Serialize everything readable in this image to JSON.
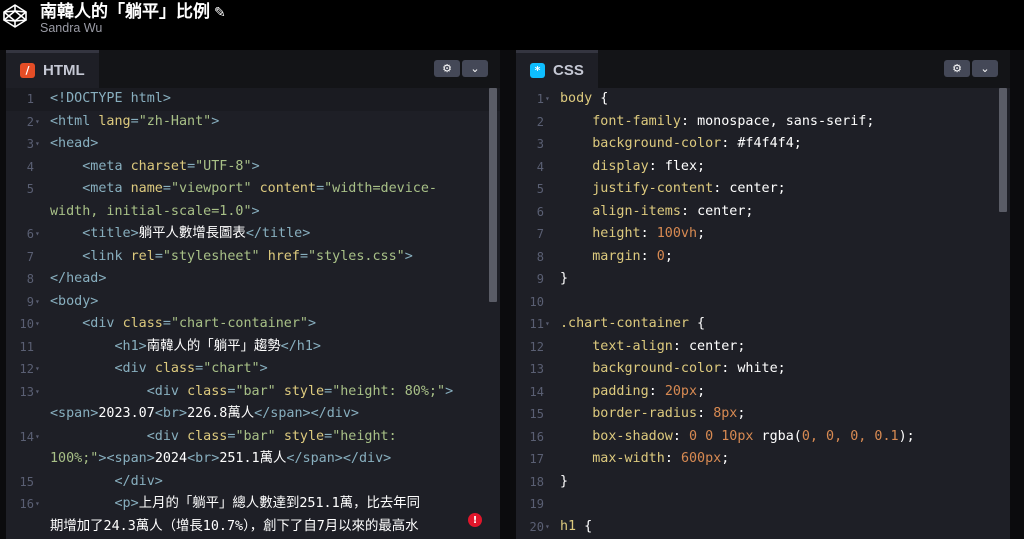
{
  "header": {
    "title": "南韓人的「躺平」比例",
    "author": "Sandra Wu"
  },
  "html_panel": {
    "tab_label": "HTML",
    "badge": "/",
    "lines": [
      {
        "n": "1",
        "fold": false,
        "highlight": true,
        "segs": [
          [
            "tag",
            "<!DOCTYPE html>"
          ]
        ]
      },
      {
        "n": "2",
        "fold": true,
        "segs": [
          [
            "tag",
            "<html "
          ],
          [
            "attr",
            "lang"
          ],
          [
            "tag",
            "="
          ],
          [
            "val",
            "\"zh-Hant\""
          ],
          [
            "tag",
            ">"
          ]
        ]
      },
      {
        "n": "3",
        "fold": true,
        "segs": [
          [
            "tag",
            "<head>"
          ]
        ]
      },
      {
        "n": "4",
        "fold": false,
        "segs": [
          [
            "tag",
            "    <meta "
          ],
          [
            "attr",
            "charset"
          ],
          [
            "tag",
            "="
          ],
          [
            "val",
            "\"UTF-8\""
          ],
          [
            "tag",
            ">"
          ]
        ]
      },
      {
        "n": "5",
        "fold": false,
        "segs": [
          [
            "tag",
            "    <meta "
          ],
          [
            "attr",
            "name"
          ],
          [
            "tag",
            "="
          ],
          [
            "val",
            "\"viewport\""
          ],
          [
            "tag",
            " "
          ],
          [
            "attr",
            "content"
          ],
          [
            "tag",
            "="
          ],
          [
            "val",
            "\"width=device-"
          ]
        ]
      },
      {
        "n": "",
        "fold": false,
        "segs": [
          [
            "val",
            "width, initial-scale=1.0\""
          ],
          [
            "tag",
            ">"
          ]
        ]
      },
      {
        "n": "6",
        "fold": true,
        "segs": [
          [
            "tag",
            "    <title>"
          ],
          [
            "white",
            "躺平人數增長圖表"
          ],
          [
            "tag",
            "</title>"
          ]
        ]
      },
      {
        "n": "7",
        "fold": false,
        "segs": [
          [
            "tag",
            "    <link "
          ],
          [
            "attr",
            "rel"
          ],
          [
            "tag",
            "="
          ],
          [
            "val",
            "\"stylesheet\""
          ],
          [
            "tag",
            " "
          ],
          [
            "attr",
            "href"
          ],
          [
            "tag",
            "="
          ],
          [
            "val",
            "\"styles.css\""
          ],
          [
            "tag",
            ">"
          ]
        ]
      },
      {
        "n": "8",
        "fold": false,
        "segs": [
          [
            "tag",
            "</head>"
          ]
        ]
      },
      {
        "n": "9",
        "fold": true,
        "segs": [
          [
            "tag",
            "<body>"
          ]
        ]
      },
      {
        "n": "10",
        "fold": true,
        "segs": [
          [
            "tag",
            "    <div "
          ],
          [
            "attr",
            "class"
          ],
          [
            "tag",
            "="
          ],
          [
            "val",
            "\"chart-container\""
          ],
          [
            "tag",
            ">"
          ]
        ]
      },
      {
        "n": "11",
        "fold": false,
        "segs": [
          [
            "tag",
            "        <h1>"
          ],
          [
            "white",
            "南韓人的「躺平」趨勢"
          ],
          [
            "tag",
            "</h1>"
          ]
        ]
      },
      {
        "n": "12",
        "fold": true,
        "segs": [
          [
            "tag",
            "        <div "
          ],
          [
            "attr",
            "class"
          ],
          [
            "tag",
            "="
          ],
          [
            "val",
            "\"chart\""
          ],
          [
            "tag",
            ">"
          ]
        ]
      },
      {
        "n": "13",
        "fold": true,
        "segs": [
          [
            "tag",
            "            <div "
          ],
          [
            "attr",
            "class"
          ],
          [
            "tag",
            "="
          ],
          [
            "val",
            "\"bar\""
          ],
          [
            "tag",
            " "
          ],
          [
            "attr",
            "style"
          ],
          [
            "tag",
            "="
          ],
          [
            "val",
            "\"height: 80%;\""
          ],
          [
            "tag",
            ">"
          ]
        ]
      },
      {
        "n": "",
        "fold": false,
        "segs": [
          [
            "tag",
            "<span>"
          ],
          [
            "white",
            "2023.07"
          ],
          [
            "tag",
            "<br>"
          ],
          [
            "white",
            "226.8萬人"
          ],
          [
            "tag",
            "</span></div>"
          ]
        ]
      },
      {
        "n": "14",
        "fold": true,
        "segs": [
          [
            "tag",
            "            <div "
          ],
          [
            "attr",
            "class"
          ],
          [
            "tag",
            "="
          ],
          [
            "val",
            "\"bar\""
          ],
          [
            "tag",
            " "
          ],
          [
            "attr",
            "style"
          ],
          [
            "tag",
            "="
          ],
          [
            "val",
            "\"height:"
          ]
        ]
      },
      {
        "n": "",
        "fold": false,
        "segs": [
          [
            "val",
            "100%;\""
          ],
          [
            "tag",
            ">"
          ],
          [
            "tag",
            "<span>"
          ],
          [
            "white",
            "2024"
          ],
          [
            "tag",
            "<br>"
          ],
          [
            "white",
            "251.1萬人"
          ],
          [
            "tag",
            "</span></div>"
          ]
        ]
      },
      {
        "n": "15",
        "fold": false,
        "segs": [
          [
            "tag",
            "        </div>"
          ]
        ]
      },
      {
        "n": "16",
        "fold": true,
        "segs": [
          [
            "tag",
            "        <p>"
          ],
          [
            "white",
            "上月的「躺平」總人數達到251.1萬，比去年同"
          ]
        ]
      },
      {
        "n": "",
        "fold": false,
        "segs": [
          [
            "white",
            "期增加了24.3萬人（增長10.7%），創下了自7月以來的最高水"
          ]
        ]
      }
    ]
  },
  "css_panel": {
    "tab_label": "CSS",
    "badge": "*",
    "lines": [
      {
        "n": "1",
        "fold": true,
        "segs": [
          [
            "sel",
            "body"
          ],
          [
            "white",
            " {"
          ]
        ]
      },
      {
        "n": "2",
        "fold": false,
        "segs": [
          [
            "prop",
            "    font-family"
          ],
          [
            "white",
            ": "
          ],
          [
            "white",
            "monospace, sans-serif;"
          ]
        ]
      },
      {
        "n": "3",
        "fold": false,
        "segs": [
          [
            "prop",
            "    background-color"
          ],
          [
            "white",
            ": "
          ],
          [
            "white",
            "#f4f4f4;"
          ]
        ]
      },
      {
        "n": "4",
        "fold": false,
        "segs": [
          [
            "prop",
            "    display"
          ],
          [
            "white",
            ": "
          ],
          [
            "white",
            "flex;"
          ]
        ]
      },
      {
        "n": "5",
        "fold": false,
        "segs": [
          [
            "prop",
            "    justify-content"
          ],
          [
            "white",
            ": "
          ],
          [
            "white",
            "center;"
          ]
        ]
      },
      {
        "n": "6",
        "fold": false,
        "segs": [
          [
            "prop",
            "    align-items"
          ],
          [
            "white",
            ": "
          ],
          [
            "white",
            "center;"
          ]
        ]
      },
      {
        "n": "7",
        "fold": false,
        "segs": [
          [
            "prop",
            "    height"
          ],
          [
            "white",
            ": "
          ],
          [
            "num",
            "100vh"
          ],
          [
            "white",
            ";"
          ]
        ]
      },
      {
        "n": "8",
        "fold": false,
        "segs": [
          [
            "prop",
            "    margin"
          ],
          [
            "white",
            ": "
          ],
          [
            "num",
            "0"
          ],
          [
            "white",
            ";"
          ]
        ]
      },
      {
        "n": "9",
        "fold": false,
        "segs": [
          [
            "white",
            "}"
          ]
        ]
      },
      {
        "n": "10",
        "fold": false,
        "segs": []
      },
      {
        "n": "11",
        "fold": true,
        "segs": [
          [
            "sel",
            ".chart-container"
          ],
          [
            "white",
            " {"
          ]
        ]
      },
      {
        "n": "12",
        "fold": false,
        "segs": [
          [
            "prop",
            "    text-align"
          ],
          [
            "white",
            ": "
          ],
          [
            "white",
            "center;"
          ]
        ]
      },
      {
        "n": "13",
        "fold": false,
        "segs": [
          [
            "prop",
            "    background-color"
          ],
          [
            "white",
            ": "
          ],
          [
            "white",
            "white;"
          ]
        ]
      },
      {
        "n": "14",
        "fold": false,
        "segs": [
          [
            "prop",
            "    padding"
          ],
          [
            "white",
            ": "
          ],
          [
            "num",
            "20px"
          ],
          [
            "white",
            ";"
          ]
        ]
      },
      {
        "n": "15",
        "fold": false,
        "segs": [
          [
            "prop",
            "    border-radius"
          ],
          [
            "white",
            ": "
          ],
          [
            "num",
            "8px"
          ],
          [
            "white",
            ";"
          ]
        ]
      },
      {
        "n": "16",
        "fold": false,
        "segs": [
          [
            "prop",
            "    box-shadow"
          ],
          [
            "white",
            ": "
          ],
          [
            "num",
            "0 0 10px"
          ],
          [
            "white",
            " rgba("
          ],
          [
            "num",
            "0, 0, 0, 0.1"
          ],
          [
            "white",
            ");"
          ]
        ]
      },
      {
        "n": "17",
        "fold": false,
        "segs": [
          [
            "prop",
            "    max-width"
          ],
          [
            "white",
            ": "
          ],
          [
            "num",
            "600px"
          ],
          [
            "white",
            ";"
          ]
        ]
      },
      {
        "n": "18",
        "fold": false,
        "segs": [
          [
            "white",
            "}"
          ]
        ]
      },
      {
        "n": "19",
        "fold": false,
        "segs": []
      },
      {
        "n": "20",
        "fold": true,
        "segs": [
          [
            "sel",
            "h1"
          ],
          [
            "white",
            " {"
          ]
        ]
      }
    ]
  },
  "icons": {
    "settings": "gear-icon",
    "collapse": "chevron-down-icon",
    "error": "error-icon",
    "edit": "pencil-icon"
  },
  "colors": {
    "html_badge": "#e44d26",
    "css_badge": "#0ebeff",
    "error": "#e1162b"
  }
}
